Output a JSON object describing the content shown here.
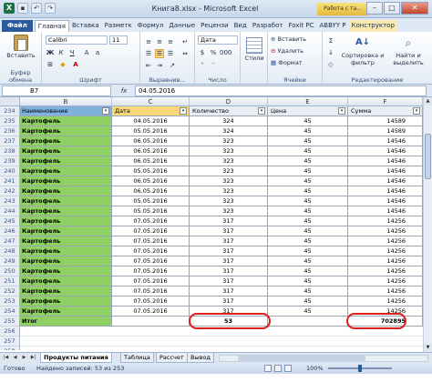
{
  "window": {
    "title": "Книга8.xlsx - Microsoft Excel",
    "context_badge": "Работа с та..."
  },
  "ribbon_tabs": [
    "Файл",
    "Главная",
    "Вставка",
    "Разметк",
    "Формул",
    "Данные",
    "Рецензи",
    "Вид",
    "Разработ",
    "Foxit PC",
    "ABBYY P",
    "Конструктор"
  ],
  "ribbon": {
    "paste_label": "Вставить",
    "clipboard_group": "Буфер обмена",
    "font_name": "Calibri",
    "font_size": "11",
    "font_group": "Шрифт",
    "alignment_group": "Выравнив...",
    "number_format": "Дата",
    "number_group": "Число",
    "styles_label": "Стили",
    "cells_insert": "Вставить",
    "cells_delete": "Удалить",
    "cells_format": "Формат",
    "cells_group": "Ячейки",
    "sort_label": "Сортировка и фильтр",
    "find_label": "Найти и выделить",
    "editing_group": "Редактирование"
  },
  "formula_bar": {
    "name_box": "B7",
    "fx": "fx",
    "value": "04.05.2016"
  },
  "columns": [
    "B",
    "C",
    "D",
    "E",
    "F"
  ],
  "table": {
    "headers": [
      "Наименование",
      "Дата",
      "Количество",
      "Цена",
      "Сумма"
    ],
    "rows": [
      {
        "n": "235",
        "name": "Картофель",
        "date": "04.05.2016",
        "qty": "324",
        "price": "45",
        "sum": "14589"
      },
      {
        "n": "236",
        "name": "Картофель",
        "date": "05.05.2016",
        "qty": "324",
        "price": "45",
        "sum": "14589"
      },
      {
        "n": "237",
        "name": "Картофель",
        "date": "06.05.2016",
        "qty": "323",
        "price": "45",
        "sum": "14546"
      },
      {
        "n": "238",
        "name": "Картофель",
        "date": "06.05.2016",
        "qty": "323",
        "price": "45",
        "sum": "14546"
      },
      {
        "n": "239",
        "name": "Картофель",
        "date": "06.05.2016",
        "qty": "323",
        "price": "45",
        "sum": "14546"
      },
      {
        "n": "240",
        "name": "Картофель",
        "date": "05.05.2016",
        "qty": "323",
        "price": "45",
        "sum": "14546"
      },
      {
        "n": "241",
        "name": "Картофель",
        "date": "06.05.2016",
        "qty": "323",
        "price": "45",
        "sum": "14546"
      },
      {
        "n": "242",
        "name": "Картофель",
        "date": "06.05.2016",
        "qty": "323",
        "price": "45",
        "sum": "14546"
      },
      {
        "n": "243",
        "name": "Картофель",
        "date": "05.05.2016",
        "qty": "323",
        "price": "45",
        "sum": "14546"
      },
      {
        "n": "244",
        "name": "Картофель",
        "date": "05.05.2016",
        "qty": "323",
        "price": "45",
        "sum": "14546"
      },
      {
        "n": "245",
        "name": "Картофель",
        "date": "07.05.2016",
        "qty": "317",
        "price": "45",
        "sum": "14256"
      },
      {
        "n": "246",
        "name": "Картофель",
        "date": "07.05.2016",
        "qty": "317",
        "price": "45",
        "sum": "14256"
      },
      {
        "n": "247",
        "name": "Картофель",
        "date": "07.05.2016",
        "qty": "317",
        "price": "45",
        "sum": "14256"
      },
      {
        "n": "248",
        "name": "Картофель",
        "date": "07.05.2016",
        "qty": "317",
        "price": "45",
        "sum": "14256"
      },
      {
        "n": "249",
        "name": "Картофель",
        "date": "07.05.2016",
        "qty": "317",
        "price": "45",
        "sum": "14256"
      },
      {
        "n": "250",
        "name": "Картофель",
        "date": "07.05.2016",
        "qty": "317",
        "price": "45",
        "sum": "14256"
      },
      {
        "n": "251",
        "name": "Картофель",
        "date": "07.05.2016",
        "qty": "317",
        "price": "45",
        "sum": "14256"
      },
      {
        "n": "252",
        "name": "Картофель",
        "date": "07.05.2016",
        "qty": "317",
        "price": "45",
        "sum": "14256"
      },
      {
        "n": "253",
        "name": "Картофель",
        "date": "07.05.2016",
        "qty": "317",
        "price": "45",
        "sum": "14256"
      },
      {
        "n": "254",
        "name": "Картофель",
        "date": "07.05.2016",
        "qty": "317",
        "price": "45",
        "sum": "14256"
      }
    ],
    "total": {
      "n": "255",
      "label": "Итог",
      "qty": "53",
      "sum": "702895"
    },
    "empty_rows": [
      "256",
      "257",
      "258",
      "259",
      "260"
    ]
  },
  "sheet_tabs": [
    "Продукты питания",
    "Таблица",
    "Рассчет",
    "Вывод"
  ],
  "status": {
    "ready": "Готово",
    "found": "Найдено записей: 53 из 253",
    "zoom": "100%"
  },
  "colors": {
    "name_fill": "#8ed062",
    "highlight": "#e01e1e",
    "file_tab": "#2a5a9e"
  }
}
